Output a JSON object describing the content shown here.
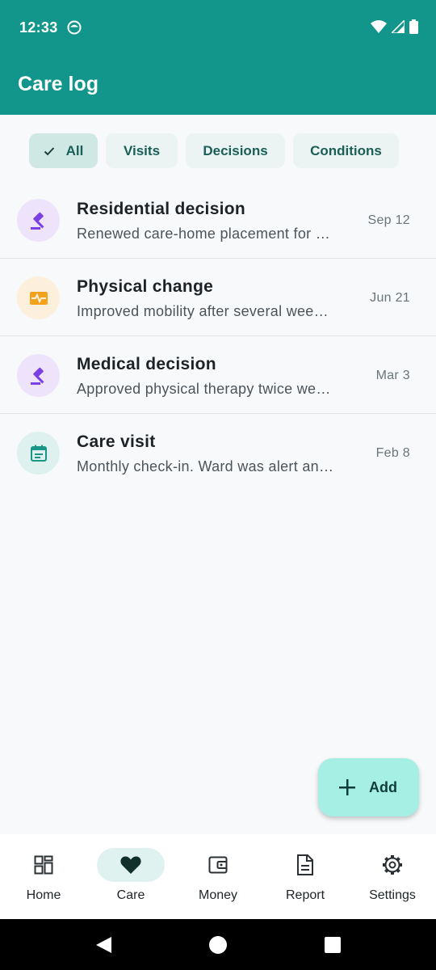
{
  "status_bar": {
    "time": "12:33"
  },
  "app_bar": {
    "title": "Care log"
  },
  "filters": [
    {
      "label": "All",
      "selected": true
    },
    {
      "label": "Visits",
      "selected": false
    },
    {
      "label": "Decisions",
      "selected": false
    },
    {
      "label": "Conditions",
      "selected": false
    }
  ],
  "log_entries": [
    {
      "title": "Residential decision",
      "description": "Renewed care-home placement for …",
      "date": "Sep 12",
      "icon": "gavel-icon",
      "icon_color": "#7b3fe4",
      "icon_bg": "#ede4fb"
    },
    {
      "title": "Physical change",
      "description": "Improved mobility after several wee…",
      "date": "Jun 21",
      "icon": "heart-monitor-icon",
      "icon_color": "#f2a21c",
      "icon_bg": "#fcefdc"
    },
    {
      "title": "Medical decision",
      "description": "Approved physical therapy twice we…",
      "date": "Mar 3",
      "icon": "gavel-icon",
      "icon_color": "#7b3fe4",
      "icon_bg": "#ede4fb"
    },
    {
      "title": "Care visit",
      "description": "Monthly check-in. Ward was alert an…",
      "date": "Feb 8",
      "icon": "calendar-icon",
      "icon_color": "#1a9688",
      "icon_bg": "#dff1ee"
    }
  ],
  "fab": {
    "label": "Add",
    "icon": "plus-icon"
  },
  "bottom_nav": [
    {
      "label": "Home",
      "icon": "dashboard-icon",
      "active": false
    },
    {
      "label": "Care",
      "icon": "heart-icon",
      "active": true
    },
    {
      "label": "Money",
      "icon": "wallet-icon",
      "active": false
    },
    {
      "label": "Report",
      "icon": "document-icon",
      "active": false
    },
    {
      "label": "Settings",
      "icon": "gear-icon",
      "active": false
    }
  ],
  "colors": {
    "primary": "#12958a",
    "fab": "#a6efe4",
    "chip": "#ebf4f2",
    "chip_selected": "#cfe8e4"
  }
}
